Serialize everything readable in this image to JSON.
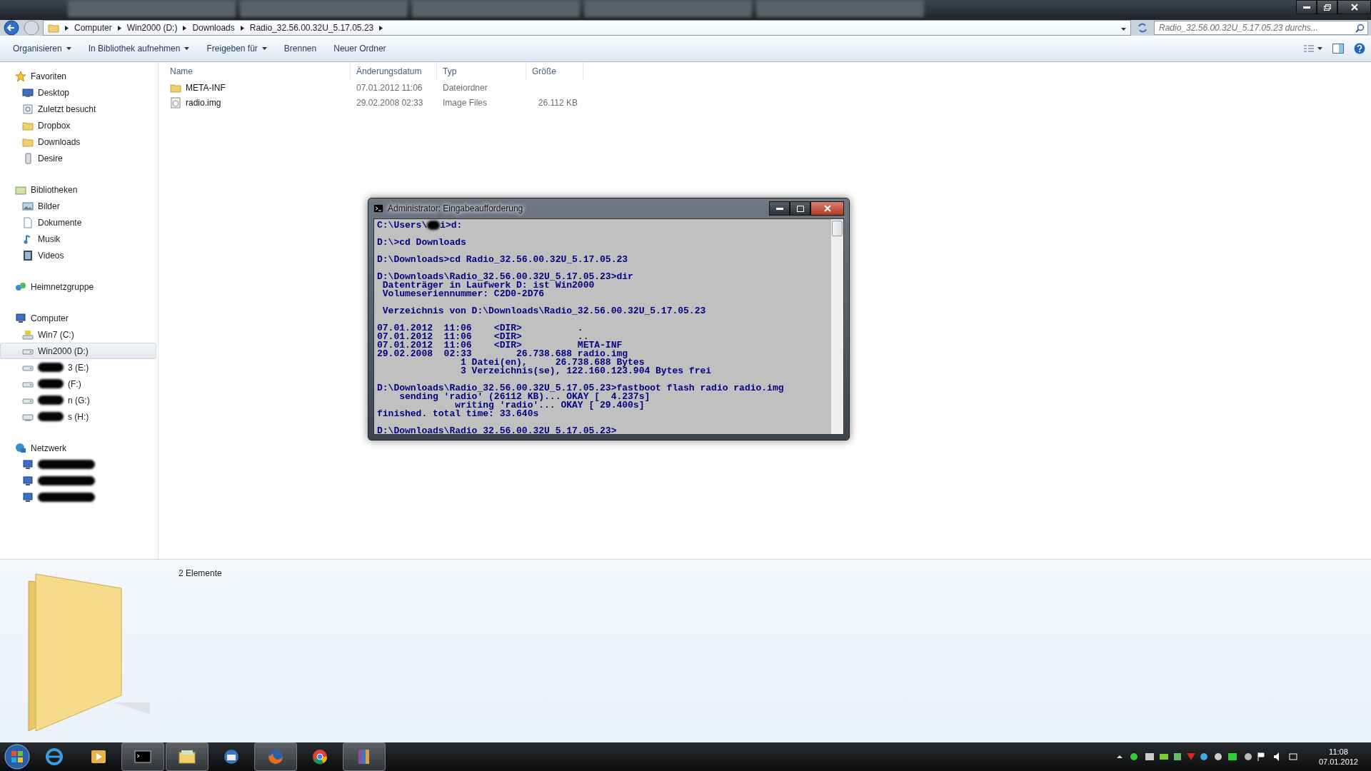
{
  "address_bar": {
    "breadcrumbs": [
      "Computer",
      "Win2000 (D:)",
      "Downloads",
      "Radio_32.56.00.32U_5.17.05.23"
    ],
    "search": {
      "placeholder": "Radio_32.56.00.32U_5.17.05.23 durchs..."
    }
  },
  "toolbar": {
    "items": [
      {
        "label": "Organisieren",
        "has_menu": true
      },
      {
        "label": "In Bibliothek aufnehmen",
        "has_menu": true
      },
      {
        "label": "Freigeben für",
        "has_menu": true
      },
      {
        "label": "Brennen",
        "has_menu": false
      },
      {
        "label": "Neuer Ordner",
        "has_menu": false
      }
    ]
  },
  "nav": {
    "sections": [
      {
        "label": "Favoriten",
        "kind": "star",
        "children": [
          {
            "label": "Desktop",
            "kind": "desktop",
            "selected": false,
            "redacted": false
          },
          {
            "label": "Zuletzt besucht",
            "kind": "recent",
            "selected": false,
            "redacted": false
          },
          {
            "label": "Dropbox",
            "kind": "folder",
            "selected": false,
            "redacted": false
          },
          {
            "label": "Downloads",
            "kind": "folder",
            "selected": false,
            "redacted": false
          },
          {
            "label": "Desire",
            "kind": "phone",
            "selected": false,
            "redacted": false
          }
        ]
      },
      {
        "label": "Bibliotheken",
        "kind": "library",
        "children": [
          {
            "label": "Bilder",
            "kind": "pictures",
            "selected": false,
            "redacted": false
          },
          {
            "label": "Dokumente",
            "kind": "document",
            "selected": false,
            "redacted": false
          },
          {
            "label": "Musik",
            "kind": "music",
            "selected": false,
            "redacted": false
          },
          {
            "label": "Videos",
            "kind": "video",
            "selected": false,
            "redacted": false
          }
        ]
      },
      {
        "label": "Heimnetzgruppe",
        "kind": "homegroup"
      },
      {
        "label": "Computer",
        "kind": "computer",
        "children": [
          {
            "label": "Win7 (C:)",
            "kind": "system-drive",
            "selected": false,
            "redacted": false
          },
          {
            "label": "Win2000 (D:)",
            "kind": "drive",
            "selected": true,
            "redacted": false
          },
          {
            "label": "3 (E:)",
            "kind": "drive",
            "selected": false,
            "redacted": true
          },
          {
            "label": "(F:)",
            "kind": "drive",
            "selected": false,
            "redacted": true
          },
          {
            "label": "n (G:)",
            "kind": "drive",
            "selected": false,
            "redacted": true
          },
          {
            "label": "s (H:)",
            "kind": "network-drive",
            "selected": false,
            "redacted": true
          }
        ]
      },
      {
        "label": "Netzwerk",
        "kind": "network",
        "children": [
          {
            "kind": "computer",
            "selected": false,
            "redacted": true
          },
          {
            "kind": "computer",
            "selected": false,
            "redacted": true
          },
          {
            "kind": "computer",
            "selected": false,
            "redacted": true
          }
        ]
      }
    ]
  },
  "file_list": {
    "columns": [
      "Name",
      "Änderungsdatum",
      "Typ",
      "Größe"
    ],
    "rows": [
      {
        "kind": "folder",
        "name": "META-INF",
        "date": "07.01.2012 11:06",
        "type": "Dateiordner"
      },
      {
        "kind": "file",
        "name": "radio.img",
        "date": "29.02.2008 02:33",
        "type": "Image Files",
        "size": "26.112 KB"
      }
    ]
  },
  "details_pane": {
    "count": "2 Elemente"
  },
  "console": {
    "title": "Administrator: Eingabeaufforderung",
    "first_line": {
      "before": "C:\\Users\\",
      "after": "i>d:"
    },
    "blocks": [
      [
        "D:\\>cd Downloads"
      ],
      [
        "D:\\Downloads>cd Radio_32.56.00.32U_5.17.05.23"
      ],
      [
        "D:\\Downloads\\Radio_32.56.00.32U_5.17.05.23>dir",
        " Datenträger in Laufwerk D: ist Win2000",
        " Volumeseriennummer: C2D0-2D76"
      ],
      [
        " Verzeichnis von D:\\Downloads\\Radio_32.56.00.32U_5.17.05.23"
      ],
      [
        "07.01.2012  11:06    <DIR>          .",
        "07.01.2012  11:06    <DIR>          ..",
        "07.01.2012  11:06    <DIR>          META-INF",
        "29.02.2008  02:33        26.738.688 radio.img",
        "               1 Datei(en),     26.738.688 Bytes",
        "               3 Verzeichnis(se), 122.160.123.904 Bytes frei"
      ],
      [
        "D:\\Downloads\\Radio_32.56.00.32U_5.17.05.23>fastboot flash radio radio.img",
        "    sending 'radio' (26112 KB)... OKAY [  4.237s]",
        "              writing 'radio'... OKAY [ 29.400s]",
        "finished. total time: 33.640s"
      ],
      [
        "D:\\Downloads\\Radio_32.56.00.32U_5.17.05.23>"
      ]
    ]
  },
  "taskbar": {
    "apps": [
      {
        "kind": "ie",
        "active": false
      },
      {
        "kind": "media",
        "active": false
      },
      {
        "kind": "console",
        "active": true
      },
      {
        "kind": "explorer",
        "active": true
      },
      {
        "kind": "mail",
        "active": false
      },
      {
        "kind": "firefox",
        "active": true
      },
      {
        "kind": "chrome",
        "active": false
      },
      {
        "kind": "archive",
        "active": true
      }
    ],
    "time": "11:08",
    "date": "07.01.2012"
  }
}
